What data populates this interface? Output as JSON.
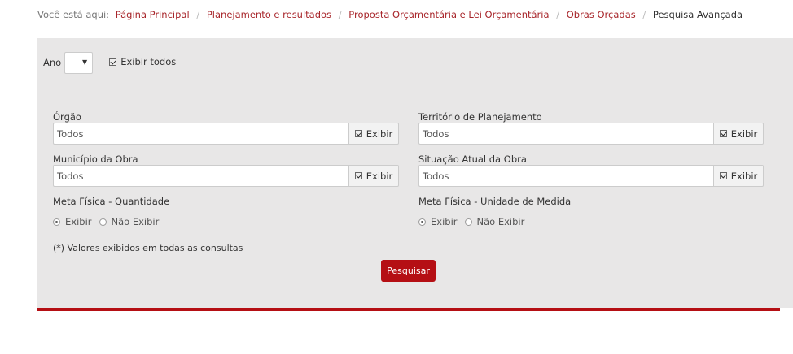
{
  "breadcrumb": {
    "prefix": "Você está aqui:",
    "items": [
      "Página Principal",
      "Planejamento e resultados",
      "Proposta Orçamentária e Lei Orçamentária",
      "Obras Orçadas"
    ],
    "current": "Pesquisa Avançada",
    "separator": "/"
  },
  "filters": {
    "ano_label": "Ano",
    "ano_value": "",
    "exibir_todos_label": "Exibir todos",
    "exibir_todos_checked": true
  },
  "fields": {
    "orgao": {
      "label": "Órgão",
      "value": "Todos",
      "exibir": "Exibir"
    },
    "territorio": {
      "label": "Território de Planejamento",
      "value": "Todos",
      "exibir": "Exibir"
    },
    "municipio": {
      "label": "Município da Obra",
      "value": "Todos",
      "exibir": "Exibir"
    },
    "situacao": {
      "label": "Situação Atual da Obra",
      "value": "Todos",
      "exibir": "Exibir"
    }
  },
  "meta_quantidade": {
    "label": "Meta Física - Quantidade",
    "opt_exibir": "Exibir",
    "opt_nao_exibir": "Não Exibir",
    "selected": "Exibir"
  },
  "meta_unidade": {
    "label": "Meta Física - Unidade de Medida",
    "opt_exibir": "Exibir",
    "opt_nao_exibir": "Não Exibir",
    "selected": "Exibir"
  },
  "note": "(*) Valores exibidos em todas as consultas",
  "search_button": "Pesquisar",
  "colors": {
    "accent": "#b50f14",
    "link": "#a8262b",
    "panel": "#e8e7e7"
  }
}
